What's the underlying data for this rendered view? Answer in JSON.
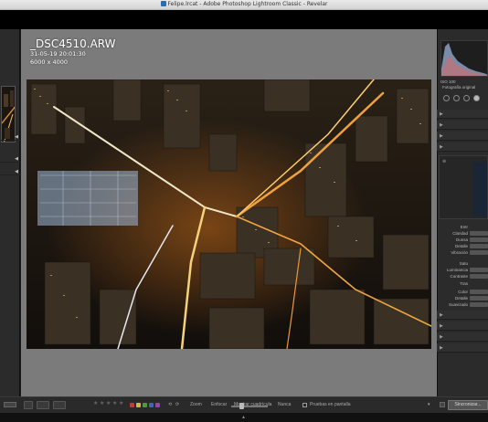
{
  "window": {
    "title": "Felipe.lrcat - Adobe Photoshop Lightroom Classic - Revelar"
  },
  "photo": {
    "filename": "_DSC4510.ARW",
    "datetime": "31-05-19 20:01:30",
    "dimensions": "6000 x 4000"
  },
  "right_panel": {
    "histogram_labels": {
      "iso": "ISO 100",
      "original_label": "Fotografía original"
    },
    "labels": [
      "Entr",
      "Claridad",
      "Dunsa",
      "Detalle",
      "Vibración",
      "Satu",
      "Luminancia",
      "Contraste",
      "Tras",
      "Color",
      "Detalle",
      "Suavizado"
    ],
    "sync_label": "Sincronizar..."
  },
  "toolbar": {
    "labels_left": [
      "Zoom",
      "Enfocar"
    ],
    "mostrar": "Mostrar cuadrícula",
    "nunca": "Nunca",
    "softproof": "Pruebas en pantalla"
  },
  "colors": {
    "label_red": "#c63a36",
    "label_yellow": "#d6b83a",
    "label_green": "#4f9a3c",
    "label_blue": "#3a69b5",
    "label_purple": "#8e4aa5"
  }
}
